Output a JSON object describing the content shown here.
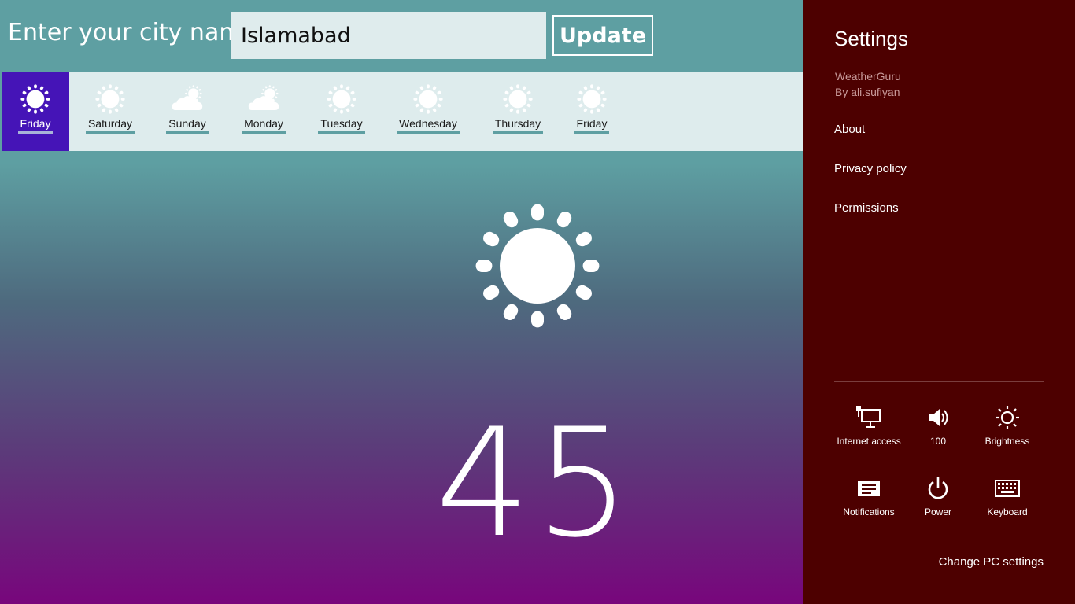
{
  "search": {
    "label": "Enter your city name:",
    "value": "Islamabad",
    "button": "Update"
  },
  "days": [
    {
      "label": "Friday",
      "icon": "sun-icon",
      "selected": true
    },
    {
      "label": "Saturday",
      "icon": "sun-icon"
    },
    {
      "label": "Sunday",
      "icon": "cloud-sun-icon"
    },
    {
      "label": "Monday",
      "icon": "cloud-sun-icon"
    },
    {
      "label": "Tuesday",
      "icon": "sun-icon"
    },
    {
      "label": "Wednesday",
      "icon": "sun-icon"
    },
    {
      "label": "Thursday",
      "icon": "sun-icon"
    },
    {
      "label": "Friday",
      "icon": "sun-icon"
    }
  ],
  "current": {
    "icon": "sun-icon",
    "temperature": "45"
  },
  "settings": {
    "title": "Settings",
    "app_name": "WeatherGuru",
    "app_author": "By ali.sufiyan",
    "menu": [
      "About",
      "Privacy policy",
      "Permissions"
    ],
    "tiles": [
      {
        "label": "Internet access",
        "icon": "network-icon"
      },
      {
        "label": "100",
        "icon": "volume-icon"
      },
      {
        "label": "Brightness",
        "icon": "brightness-icon"
      },
      {
        "label": "Notifications",
        "icon": "notifications-icon"
      },
      {
        "label": "Power",
        "icon": "power-icon"
      },
      {
        "label": "Keyboard",
        "icon": "keyboard-icon"
      }
    ],
    "change_pc_settings": "Change PC settings"
  },
  "colors": {
    "panel_bg": "#4d0000",
    "selected_day_bg": "#4514b7",
    "days_bar_bg": "#deeced",
    "teal": "#5e9fa2",
    "purple": "#78067c"
  }
}
